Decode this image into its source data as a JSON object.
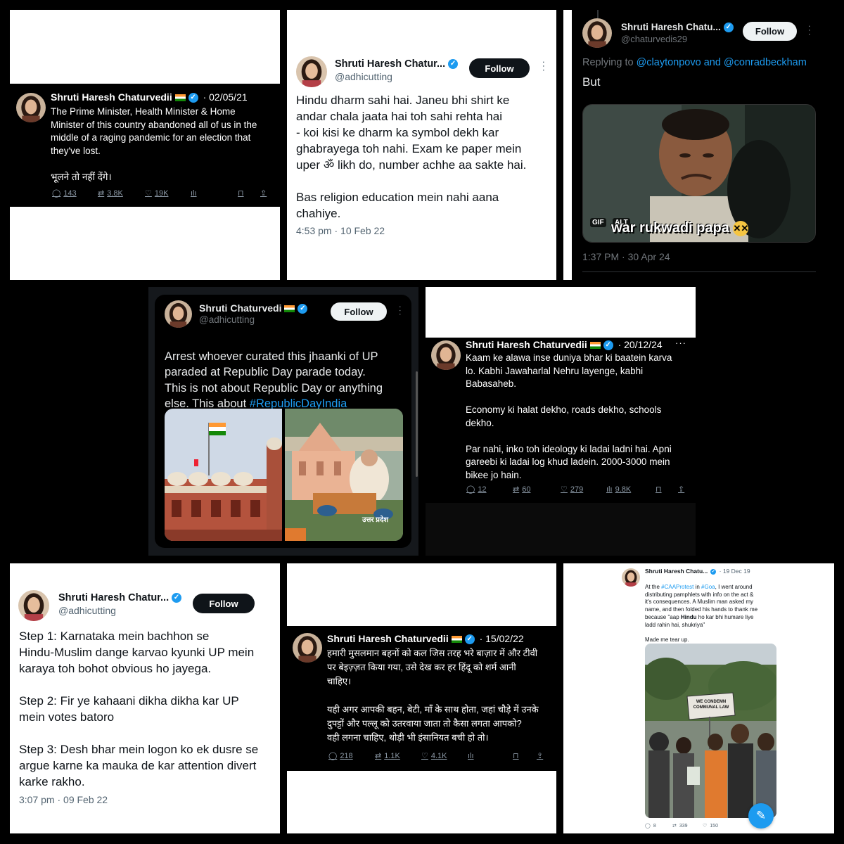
{
  "p1": {
    "name": "Shruti Haresh Chaturvedii",
    "date": "· 02/05/21",
    "text": "The Prime Minister, Health Minister & Home\nMinister of this country abandoned all of us in the\nmiddle of a raging pandemic for an election that\nthey've lost.\n\nभूलने तो नहीं देंगे।",
    "replies": "143",
    "retweets": "3.8K",
    "likes": "19K"
  },
  "p2": {
    "name": "Shruti Haresh Chatur...",
    "handle": "@adhicutting",
    "follow": "Follow",
    "text": "Hindu dharm sahi hai. Janeu bhi shirt ke\nandar chala jaata hai toh sahi rehta hai\n- koi kisi ke dharm ka symbol dekh kar\nghabrayega toh nahi. Exam ke paper mein\nuper ॐ likh do, number achhe aa sakte hai.\n\nBas religion education mein nahi aana\nchahiye.",
    "time": "4:53 pm · 10 Feb 22"
  },
  "p3": {
    "name": "Shruti Haresh Chatu...",
    "handle": "@chaturvedis29",
    "follow": "Follow",
    "replying_prefix": "Replying to ",
    "replying_to": "@claytonpovo and @conradbeckham",
    "text": "But",
    "gif_badge": "GIF",
    "alt_badge": "ALT",
    "caption": "war rukwadi papa",
    "time": "1:37 PM · 30 Apr 24"
  },
  "p4": {
    "name": "Shruti Chaturvedi",
    "handle": "@adhicutting",
    "follow": "Follow",
    "text": "Arrest whoever curated this jhaanki of UP\nparaded at Republic Day parade today.\nThis is not about Republic Day or anything\nelse. This about ",
    "hashtag": "#RepublicDayIndia",
    "tableau_label": "उत्तर प्रदेश"
  },
  "p5": {
    "name": "Shruti Haresh Chaturvedii",
    "date": "· 20/12/24",
    "text": "Kaam ke alawa inse duniya bhar ki baatein karva\nlo. Kabhi Jawaharlal Nehru layenge, kabhi\nBabasaheb.\n\nEconomy ki halat dekho, roads dekho, schools\ndekho.\n\nPar nahi, inko toh ideology ki ladai ladni hai. Apni\ngareebi ki ladai log khud ladein. 2000-3000 mein\nbikee jo hain.",
    "replies": "12",
    "retweets": "60",
    "likes": "279",
    "views": "9.8K"
  },
  "p6": {
    "name": "Shruti Haresh Chatur...",
    "handle": "@adhicutting",
    "follow": "Follow",
    "text": "Step 1: Karnataka mein bachhon se\nHindu-Muslim dange karvao kyunki UP mein\nkaraya toh bohot obvious ho jayega.\n\nStep 2: Fir ye kahaani dikha dikha kar UP\nmein votes batoro\n\nStep 3: Desh bhar mein logon ko ek dusre se\nargue karne ka mauka de kar attention divert\nkarke rakho.",
    "time": "3:07 pm · 09 Feb 22"
  },
  "p7": {
    "name": "Shruti Haresh Chaturvedii",
    "date": "· 15/02/22",
    "text": "हमारी मुसलमान बहनों को कल जिस तरह भरे बाज़ार में और टीवी\nपर बेइज़्ज़त किया गया, उसे देख कर हर हिंदू को शर्म आनी\nचाहिए।\n\nयही अगर आपकी बहन, बेटी, माँ के साथ होता, जहां चौड़े में उनके\nदुपट्टों और पल्लू को उतरवाया जाता तो कैसा लगता आपको?\nवही लगना चाहिए, थोड़ी भी इंसानियत बची हो तो।",
    "replies": "218",
    "retweets": "1.1K",
    "likes": "4.1K"
  },
  "p8": {
    "name": "Shruti Haresh Chatu...",
    "date": "· 19 Dec 19",
    "t1": "At the ",
    "tag1": "#CAAProtest",
    "t2": " in ",
    "tag2": "#Goa",
    "t3": ", I went around\ndistributing pamphlets with info on the act &\nit's consequences. A Muslim man asked my\nname, and then folded his hands to thank me\nbecause \"aap ",
    "bold": "Hindu",
    "t4": " ho kar bhi humare liye\nladd rahin hai, shukriya\"\n\nMade me tear up.",
    "sign_text": "WE CONDEMN\nCOMMUNAL LAW",
    "replies": "8",
    "retweets": "339",
    "likes": "150"
  }
}
